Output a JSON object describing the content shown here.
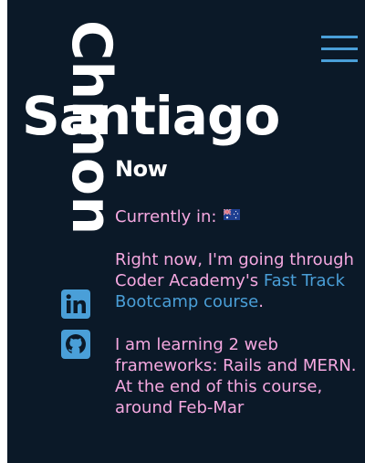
{
  "header": {
    "first_name": "Santiago",
    "last_name": "Chmon"
  },
  "menu": {
    "icon": "hamburger-menu-icon"
  },
  "social": {
    "linkedin_icon": "linkedin-icon",
    "github_icon": "github-icon"
  },
  "now": {
    "title": "Now",
    "currently_in_label": "Currently in:",
    "flag_icon": "australia-flag-icon",
    "para1_prefix": "Right now, I'm going through Coder Academy's",
    "para1_link": "Fast Track Bootcamp course",
    "para1_suffix": ".",
    "para2": "I am learning 2 web frameworks: Rails and MERN. At the end of this course, around Feb-Mar"
  },
  "colors": {
    "background": "#0b1928",
    "accent_blue": "#4a9fd8",
    "body_pink": "#f5a8e0",
    "heading_white": "#ffffff"
  }
}
